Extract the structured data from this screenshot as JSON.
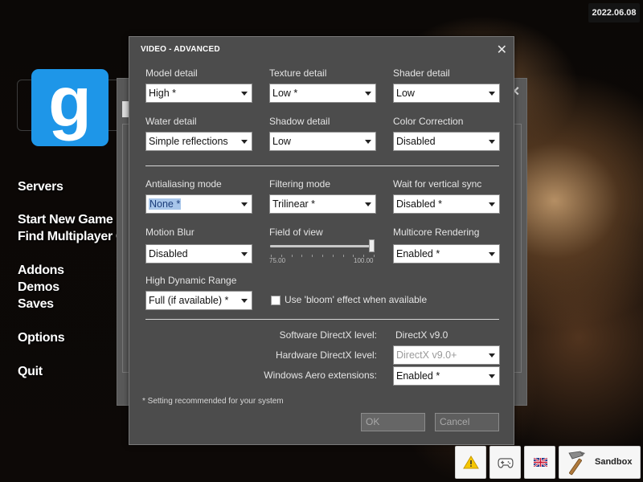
{
  "date": "2022.06.08",
  "logo_letter": "g",
  "main_menu": [
    "Servers",
    "Start New Game",
    "Find Multiplayer Ga",
    "Addons",
    "Demos",
    "Saves",
    "Options",
    "Quit"
  ],
  "dialog": {
    "title": "VIDEO - ADVANCED",
    "fields": {
      "model_detail": {
        "label": "Model detail",
        "value": "High *"
      },
      "texture_detail": {
        "label": "Texture detail",
        "value": "Low *"
      },
      "shader_detail": {
        "label": "Shader detail",
        "value": "Low"
      },
      "water_detail": {
        "label": "Water detail",
        "value": "Simple reflections"
      },
      "shadow_detail": {
        "label": "Shadow detail",
        "value": "Low"
      },
      "color_correction": {
        "label": "Color Correction",
        "value": "Disabled"
      },
      "antialiasing": {
        "label": "Antialiasing mode",
        "value": "None *"
      },
      "filtering": {
        "label": "Filtering mode",
        "value": "Trilinear *"
      },
      "vsync": {
        "label": "Wait for vertical sync",
        "value": "Disabled *"
      },
      "motion_blur": {
        "label": "Motion Blur",
        "value": "Disabled"
      },
      "multicore": {
        "label": "Multicore Rendering",
        "value": "Enabled *"
      },
      "hdr": {
        "label": "High Dynamic Range",
        "value": "Full (if available) *"
      }
    },
    "fov": {
      "label": "Field of view",
      "min_label": "75.00",
      "max_label": "100.00",
      "value_fraction": 1.0
    },
    "bloom_label": "Use 'bloom' effect when available",
    "bloom_checked": false,
    "software_dx": {
      "label": "Software DirectX level:",
      "value": "DirectX v9.0"
    },
    "hardware_dx": {
      "label": "Hardware DirectX level:",
      "value": "DirectX v9.0+"
    },
    "aero": {
      "label": "Windows Aero extensions:",
      "value": "Enabled *"
    },
    "note": "* Setting recommended for your system",
    "ok": "OK",
    "cancel": "Cancel"
  },
  "tray": {
    "warning_icon": "warning-icon",
    "controller_icon": "gamepad-icon",
    "language_icon": "uk-flag-icon",
    "gamemode_label": "Sandbox"
  }
}
